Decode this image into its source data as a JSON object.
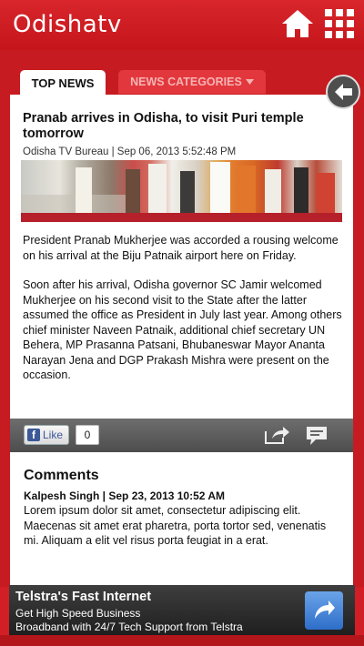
{
  "header": {
    "logo": "Odishatv",
    "home_icon": "home-icon",
    "menu_icon": "grid-icon"
  },
  "tabs": {
    "top_news": "TOP NEWS",
    "categories": "NEWS CATEGORIES"
  },
  "article": {
    "headline": "Pranab arrives in Odisha, to visit Puri temple tomorrow",
    "byline": "Odisha TV Bureau | Sep 06, 2013 5:52:48 PM",
    "paragraphs": [
      "President Pranab Mukherjee was accorded a rousing welcome on his arrival at the Biju Patnaik airport here on Friday.",
      "Soon after his arrival, Odisha governor SC Jamir welcomed Mukherjee on his second visit to the State after the latter assumed the office as President in July last year. Among others chief minister Naveen Patnaik, additional chief secretary UN Behera, MP Prasanna Patsani, Bhubaneswar Mayor Ananta Narayan Jena and DGP Prakash Mishra were present on the occasion."
    ]
  },
  "share": {
    "like_label": "Like",
    "like_count": "0"
  },
  "comments": {
    "title": "Comments",
    "meta": "Kalpesh Singh |  Sep 23, 2013 10:52 AM",
    "body": "Lorem ipsum dolor sit amet, consectetur adipiscing elit. Maecenas sit amet erat pharetra, porta tortor sed, venenatis mi. Aliquam a elit vel risus porta feugiat in a erat."
  },
  "ad": {
    "title": "Telstra's Fast Internet",
    "line1": "Get High Speed Business",
    "line2": "Broadband with 24/7 Tech Support from Telstra"
  },
  "colors": {
    "brand_red": "#d11f25",
    "ad_blue": "#2e6ec9"
  }
}
